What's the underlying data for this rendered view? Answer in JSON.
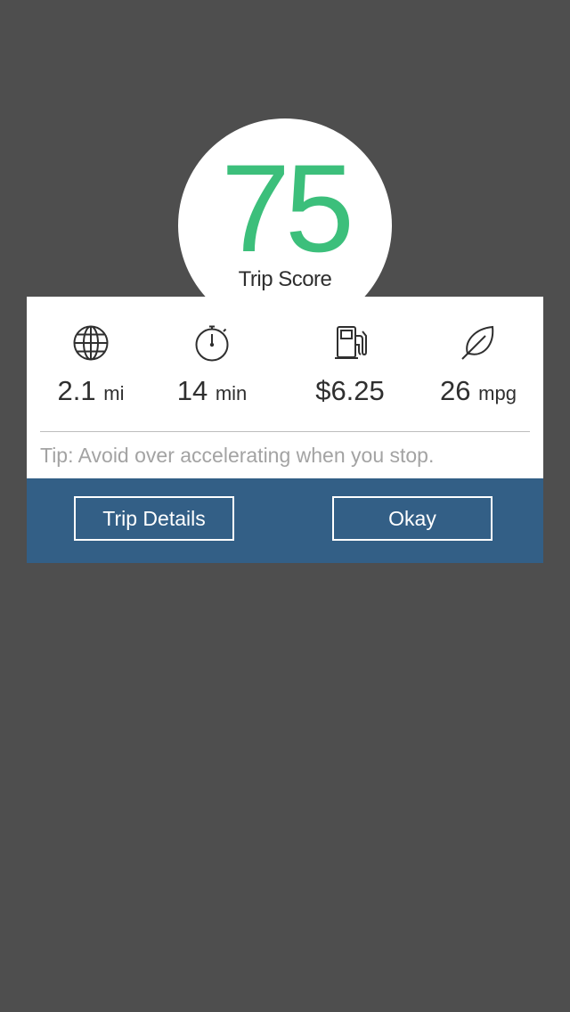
{
  "score": {
    "value": "75",
    "label": "Trip Score",
    "color": "#3cbf7b"
  },
  "stats": [
    {
      "icon": "globe-icon",
      "value": "2.1",
      "unit": "mi"
    },
    {
      "icon": "stopwatch-icon",
      "value": "14",
      "unit": "min"
    },
    {
      "icon": "fuel-pump-icon",
      "value": "$6.25",
      "unit": ""
    },
    {
      "icon": "leaf-icon",
      "value": "26",
      "unit": "mpg"
    }
  ],
  "tip": "Tip: Avoid over accelerating when you stop.",
  "actions": {
    "trip_details_label": "Trip Details",
    "okay_label": "Okay",
    "bar_color": "#335f86"
  },
  "colors": {
    "background": "#4e4e4e",
    "card": "#ffffff",
    "tip_text": "#a3a3a3"
  }
}
